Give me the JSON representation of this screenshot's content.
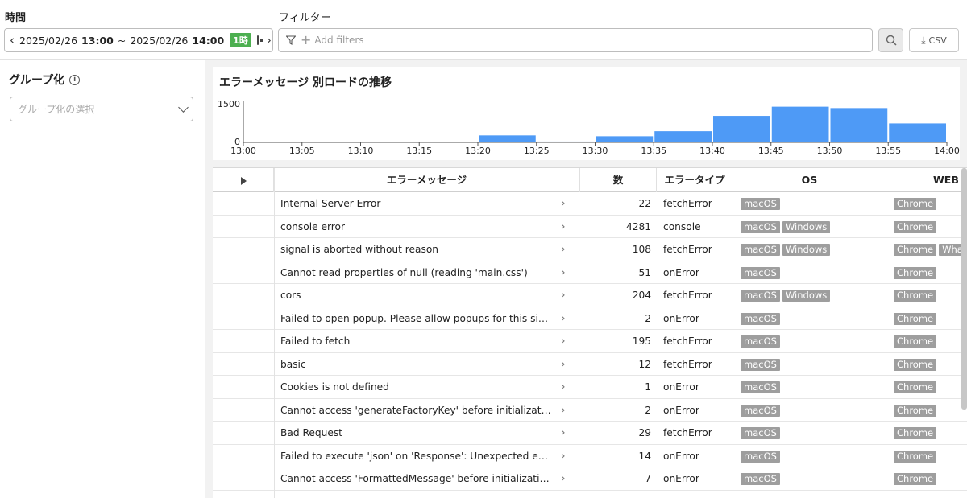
{
  "header": {
    "time_label": "時間",
    "filter_label": "フィルター",
    "time_range": {
      "start_date": "2025/02/26",
      "start_time": "13:00",
      "separator": "~",
      "end_date": "2025/02/26",
      "end_time": "14:00",
      "duration_badge": "1時"
    },
    "filter_placeholder": "Add filters",
    "csv_label": "CSV"
  },
  "sidebar": {
    "group_title": "グループ化",
    "group_placeholder": "グループ化の選択"
  },
  "chart": {
    "title": "エラーメッセージ 別ロードの推移"
  },
  "chart_data": {
    "type": "bar",
    "title": "エラーメッセージ 別ロードの推移",
    "categories": [
      "13:00",
      "13:05",
      "13:10",
      "13:15",
      "13:20",
      "13:25",
      "13:30",
      "13:35",
      "13:40",
      "13:45",
      "13:50",
      "13:55"
    ],
    "values": [
      0,
      0,
      0,
      0,
      250,
      30,
      220,
      400,
      950,
      1280,
      1230,
      680
    ],
    "x_ticks": [
      "13:00",
      "13:05",
      "13:10",
      "13:15",
      "13:20",
      "13:25",
      "13:30",
      "13:35",
      "13:40",
      "13:45",
      "13:50",
      "13:55",
      "14:00"
    ],
    "y_ticks": [
      "0",
      "1500"
    ],
    "ylim": [
      0,
      1500
    ],
    "bar_color": "#4e9af6"
  },
  "table": {
    "headers": [
      "エラーメッセージ",
      "数",
      "エラータイプ",
      "OS",
      "WEB"
    ],
    "rows": [
      {
        "msg": "Internal Server Error",
        "count": "22",
        "type": "fetchError",
        "os": [
          "macOS"
        ],
        "web": [
          "Chrome"
        ]
      },
      {
        "msg": "console error",
        "count": "4281",
        "type": "console",
        "os": [
          "macOS",
          "Windows"
        ],
        "web": [
          "Chrome"
        ]
      },
      {
        "msg": "signal is aborted without reason",
        "count": "108",
        "type": "fetchError",
        "os": [
          "macOS",
          "Windows"
        ],
        "web": [
          "Chrome",
          "Wha"
        ]
      },
      {
        "msg": "Cannot read properties of null (reading 'main.css')",
        "count": "51",
        "type": "onError",
        "os": [
          "macOS"
        ],
        "web": [
          "Chrome"
        ]
      },
      {
        "msg": "cors",
        "count": "204",
        "type": "fetchError",
        "os": [
          "macOS",
          "Windows"
        ],
        "web": [
          "Chrome"
        ]
      },
      {
        "msg": "Failed to open popup. Please allow popups for this site to vi…",
        "count": "2",
        "type": "onError",
        "os": [
          "macOS"
        ],
        "web": [
          "Chrome"
        ]
      },
      {
        "msg": "Failed to fetch",
        "count": "195",
        "type": "fetchError",
        "os": [
          "macOS"
        ],
        "web": [
          "Chrome"
        ]
      },
      {
        "msg": "basic",
        "count": "12",
        "type": "fetchError",
        "os": [
          "macOS"
        ],
        "web": [
          "Chrome"
        ]
      },
      {
        "msg": "Cookies is not defined",
        "count": "1",
        "type": "onError",
        "os": [
          "macOS"
        ],
        "web": [
          "Chrome"
        ]
      },
      {
        "msg": "Cannot access 'generateFactoryKey' before initialization",
        "count": "2",
        "type": "onError",
        "os": [
          "macOS"
        ],
        "web": [
          "Chrome"
        ]
      },
      {
        "msg": "Bad Request",
        "count": "29",
        "type": "fetchError",
        "os": [
          "macOS"
        ],
        "web": [
          "Chrome"
        ]
      },
      {
        "msg": "Failed to execute 'json' on 'Response': Unexpected end of JS…",
        "count": "14",
        "type": "onError",
        "os": [
          "macOS"
        ],
        "web": [
          "Chrome"
        ]
      },
      {
        "msg": "Cannot access 'FormattedMessage' before initialization",
        "count": "7",
        "type": "onError",
        "os": [
          "macOS"
        ],
        "web": [
          "Chrome"
        ]
      }
    ]
  }
}
